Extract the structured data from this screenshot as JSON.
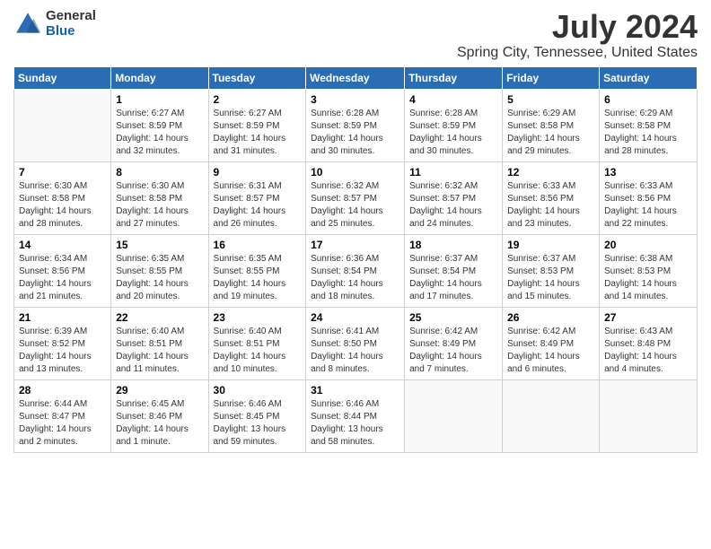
{
  "logo": {
    "general": "General",
    "blue": "Blue"
  },
  "title": "July 2024",
  "location": "Spring City, Tennessee, United States",
  "days_of_week": [
    "Sunday",
    "Monday",
    "Tuesday",
    "Wednesday",
    "Thursday",
    "Friday",
    "Saturday"
  ],
  "weeks": [
    [
      {
        "day": "",
        "info": ""
      },
      {
        "day": "1",
        "info": "Sunrise: 6:27 AM\nSunset: 8:59 PM\nDaylight: 14 hours\nand 32 minutes."
      },
      {
        "day": "2",
        "info": "Sunrise: 6:27 AM\nSunset: 8:59 PM\nDaylight: 14 hours\nand 31 minutes."
      },
      {
        "day": "3",
        "info": "Sunrise: 6:28 AM\nSunset: 8:59 PM\nDaylight: 14 hours\nand 30 minutes."
      },
      {
        "day": "4",
        "info": "Sunrise: 6:28 AM\nSunset: 8:59 PM\nDaylight: 14 hours\nand 30 minutes."
      },
      {
        "day": "5",
        "info": "Sunrise: 6:29 AM\nSunset: 8:58 PM\nDaylight: 14 hours\nand 29 minutes."
      },
      {
        "day": "6",
        "info": "Sunrise: 6:29 AM\nSunset: 8:58 PM\nDaylight: 14 hours\nand 28 minutes."
      }
    ],
    [
      {
        "day": "7",
        "info": "Sunrise: 6:30 AM\nSunset: 8:58 PM\nDaylight: 14 hours\nand 28 minutes."
      },
      {
        "day": "8",
        "info": "Sunrise: 6:30 AM\nSunset: 8:58 PM\nDaylight: 14 hours\nand 27 minutes."
      },
      {
        "day": "9",
        "info": "Sunrise: 6:31 AM\nSunset: 8:57 PM\nDaylight: 14 hours\nand 26 minutes."
      },
      {
        "day": "10",
        "info": "Sunrise: 6:32 AM\nSunset: 8:57 PM\nDaylight: 14 hours\nand 25 minutes."
      },
      {
        "day": "11",
        "info": "Sunrise: 6:32 AM\nSunset: 8:57 PM\nDaylight: 14 hours\nand 24 minutes."
      },
      {
        "day": "12",
        "info": "Sunrise: 6:33 AM\nSunset: 8:56 PM\nDaylight: 14 hours\nand 23 minutes."
      },
      {
        "day": "13",
        "info": "Sunrise: 6:33 AM\nSunset: 8:56 PM\nDaylight: 14 hours\nand 22 minutes."
      }
    ],
    [
      {
        "day": "14",
        "info": "Sunrise: 6:34 AM\nSunset: 8:56 PM\nDaylight: 14 hours\nand 21 minutes."
      },
      {
        "day": "15",
        "info": "Sunrise: 6:35 AM\nSunset: 8:55 PM\nDaylight: 14 hours\nand 20 minutes."
      },
      {
        "day": "16",
        "info": "Sunrise: 6:35 AM\nSunset: 8:55 PM\nDaylight: 14 hours\nand 19 minutes."
      },
      {
        "day": "17",
        "info": "Sunrise: 6:36 AM\nSunset: 8:54 PM\nDaylight: 14 hours\nand 18 minutes."
      },
      {
        "day": "18",
        "info": "Sunrise: 6:37 AM\nSunset: 8:54 PM\nDaylight: 14 hours\nand 17 minutes."
      },
      {
        "day": "19",
        "info": "Sunrise: 6:37 AM\nSunset: 8:53 PM\nDaylight: 14 hours\nand 15 minutes."
      },
      {
        "day": "20",
        "info": "Sunrise: 6:38 AM\nSunset: 8:53 PM\nDaylight: 14 hours\nand 14 minutes."
      }
    ],
    [
      {
        "day": "21",
        "info": "Sunrise: 6:39 AM\nSunset: 8:52 PM\nDaylight: 14 hours\nand 13 minutes."
      },
      {
        "day": "22",
        "info": "Sunrise: 6:40 AM\nSunset: 8:51 PM\nDaylight: 14 hours\nand 11 minutes."
      },
      {
        "day": "23",
        "info": "Sunrise: 6:40 AM\nSunset: 8:51 PM\nDaylight: 14 hours\nand 10 minutes."
      },
      {
        "day": "24",
        "info": "Sunrise: 6:41 AM\nSunset: 8:50 PM\nDaylight: 14 hours\nand 8 minutes."
      },
      {
        "day": "25",
        "info": "Sunrise: 6:42 AM\nSunset: 8:49 PM\nDaylight: 14 hours\nand 7 minutes."
      },
      {
        "day": "26",
        "info": "Sunrise: 6:42 AM\nSunset: 8:49 PM\nDaylight: 14 hours\nand 6 minutes."
      },
      {
        "day": "27",
        "info": "Sunrise: 6:43 AM\nSunset: 8:48 PM\nDaylight: 14 hours\nand 4 minutes."
      }
    ],
    [
      {
        "day": "28",
        "info": "Sunrise: 6:44 AM\nSunset: 8:47 PM\nDaylight: 14 hours\nand 2 minutes."
      },
      {
        "day": "29",
        "info": "Sunrise: 6:45 AM\nSunset: 8:46 PM\nDaylight: 14 hours\nand 1 minute."
      },
      {
        "day": "30",
        "info": "Sunrise: 6:46 AM\nSunset: 8:45 PM\nDaylight: 13 hours\nand 59 minutes."
      },
      {
        "day": "31",
        "info": "Sunrise: 6:46 AM\nSunset: 8:44 PM\nDaylight: 13 hours\nand 58 minutes."
      },
      {
        "day": "",
        "info": ""
      },
      {
        "day": "",
        "info": ""
      },
      {
        "day": "",
        "info": ""
      }
    ]
  ]
}
